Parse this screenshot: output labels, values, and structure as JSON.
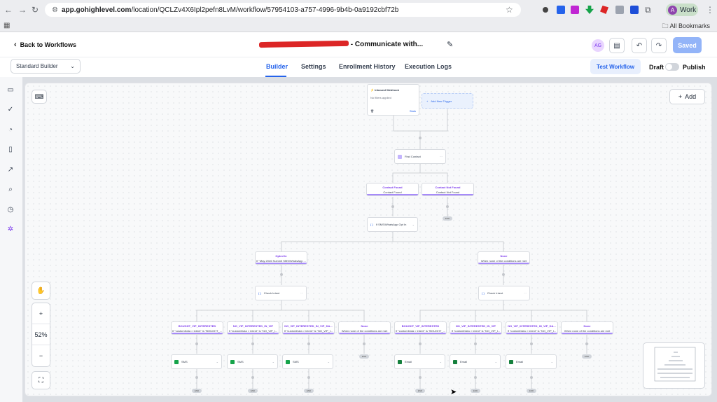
{
  "browser": {
    "url_domain": "app.gohighlevel.com",
    "url_path": "/location/QCLZv4X6Ipl2pefn8LvM/workflow/57954103-a757-4996-9b4b-0a9192cbf72b",
    "profile_label": "Work",
    "profile_initial": "A",
    "bookmarks_label": "All Bookmarks"
  },
  "header": {
    "back_label": "Back to Workflows",
    "workflow_name": "- Communicate with...",
    "avatar_initials": "AG",
    "saved_label": "Saved"
  },
  "tabs": {
    "builder_select": "Standard Builder",
    "items": [
      "Builder",
      "Settings",
      "Enrollment History",
      "Execution Logs"
    ],
    "test_workflow": "Test Workflow",
    "draft_label": "Draft",
    "publish_label": "Publish"
  },
  "canvas": {
    "add_label": "Add",
    "zoom_level": "52%",
    "trigger": {
      "title": "Inbound Webhook",
      "filter": "No filters applied",
      "stats": "Stats"
    },
    "add_trigger": "Add New Trigger",
    "find_contact": "Find Contact",
    "contact_found": {
      "title": "Contact Found",
      "sub": "Contact Found"
    },
    "contact_not_found": {
      "title": "Contact Not Found",
      "sub": "Contact Not Found"
    },
    "if_else": "If SMS/WhatsApp Opt In",
    "opted_in": {
      "title": "Opted In",
      "sub": "If \"May 2026 Summit SMS/WhatsApp ..."
    },
    "none_top": {
      "title": "None",
      "sub": "When none of the conditions are met"
    },
    "check_intent_left": "Check Intent",
    "check_intent_right": "Check Intent",
    "branches_left": [
      {
        "title": "BOUGHT_VIP_INTERESTED",
        "sub": "If \"customData > intent\" is \"BOUGHT_..."
      },
      {
        "title": "NO_VIP_INTERESTED_IN_VIP",
        "sub": "If \"customData > intent\" is \"NO_VIP_I..."
      },
      {
        "title": "NO_VIP_INTERESTED_IN_VIP_DA...",
        "sub": "If \"customData > intent\" is \"NO_VIP_I..."
      },
      {
        "title": "None",
        "sub": "When none of the conditions are met"
      }
    ],
    "branches_right": [
      {
        "title": "BOUGHT_VIP_INTERESTED",
        "sub": "If \"customData > intent\" is \"BOUGHT_..."
      },
      {
        "title": "NO_VIP_INTERESTED_IN_VIP",
        "sub": "If \"customData > intent\" is \"NO_VIP_I..."
      },
      {
        "title": "NO_VIP_INTERESTED_IN_VIP_DA...",
        "sub": "If \"customData > intent\" is \"NO_VIP_I..."
      },
      {
        "title": "None",
        "sub": "When none of the conditions are met"
      }
    ],
    "actions_left": [
      "SMS",
      "SMS",
      "SMS"
    ],
    "actions_right": [
      "Email",
      "Email",
      "Email"
    ],
    "end_label": "END"
  },
  "colors": {
    "accent": "#2563eb",
    "purple": "#7c3aed",
    "sms_green": "#16a34a",
    "email_green": "#15803d"
  }
}
